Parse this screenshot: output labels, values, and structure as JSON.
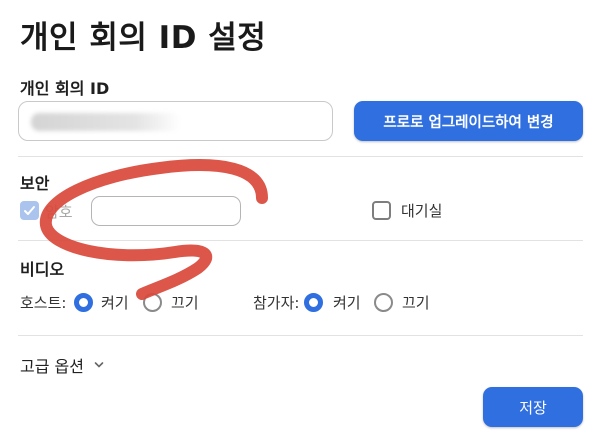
{
  "page": {
    "title": "개인 회의 ID 설정"
  },
  "meeting_id": {
    "section_label": "개인 회의 ID",
    "upgrade_button_label": "프로로 업그레이드하여 변경"
  },
  "security": {
    "section_label": "보안",
    "password_label": "암호",
    "password_checked": true,
    "waiting_room_label": "대기실",
    "waiting_room_checked": false
  },
  "video": {
    "section_label": "비디오",
    "host_label": "호스트:",
    "participant_label": "참가자:",
    "on_label": "켜기",
    "off_label": "끄기",
    "host_selected": "켜기",
    "participant_selected": "켜기"
  },
  "advanced": {
    "label": "고급 옵션"
  },
  "save_button_label": "저장",
  "colors": {
    "accent": "#2f6fe0",
    "annotation": "#d9483a"
  }
}
